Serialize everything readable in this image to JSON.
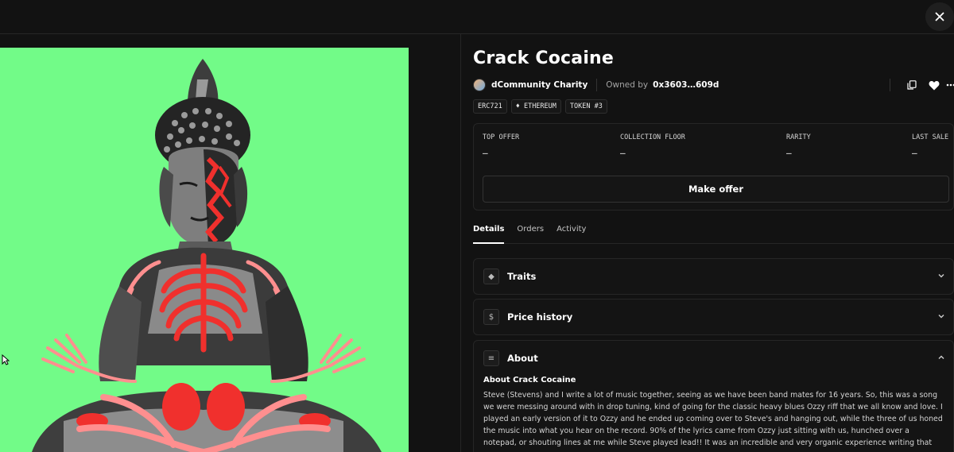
{
  "item": {
    "title": "Crack Cocaine",
    "collection": "dCommunity Charity",
    "owned_by_label": "Owned by",
    "owner": "0x3603…609d",
    "tags": [
      "ERC721",
      "♦ ETHEREUM",
      "TOKEN #3"
    ]
  },
  "stats": [
    {
      "label": "TOP OFFER",
      "value": "–"
    },
    {
      "label": "COLLECTION FLOOR",
      "value": "–"
    },
    {
      "label": "RARITY",
      "value": "–"
    },
    {
      "label": "LAST SALE",
      "value": "–"
    }
  ],
  "make_offer_label": "Make offer",
  "tabs": [
    {
      "label": "Details",
      "active": true
    },
    {
      "label": "Orders",
      "active": false
    },
    {
      "label": "Activity",
      "active": false
    }
  ],
  "sections": {
    "traits": {
      "label": "Traits",
      "icon": "◆"
    },
    "price_history": {
      "label": "Price history",
      "icon": "$"
    },
    "about": {
      "label": "About",
      "icon": "≡",
      "heading": "About Crack Cocaine",
      "text": "Steve (Stevens) and I write a lot of music together, seeing as we have been band mates for 16 years. So, this was a song we were messing around with in drop tuning, kind of going for the classic heavy blues Ozzy riff that we all know and love. I played an early version of it to Ozzy and he ended up coming over to Steve's and hanging out, while the three of us honed the music into what you hear on the record. 90% of the lyrics came from Ozzy just sitting with us, hunched over a notepad, or shouting lines at me while Steve played lead!! It was an incredible and very organic experience writing that song."
    }
  },
  "colors": {
    "background": "#121212",
    "art_background": "#72fb88",
    "art_red": "#f0302d",
    "art_pink": "#ff8f8f"
  },
  "icons": [
    "close-icon",
    "copy-icon",
    "heart-icon",
    "more-icon",
    "chevron-down-icon",
    "chevron-up-icon",
    "cursor-icon"
  ]
}
